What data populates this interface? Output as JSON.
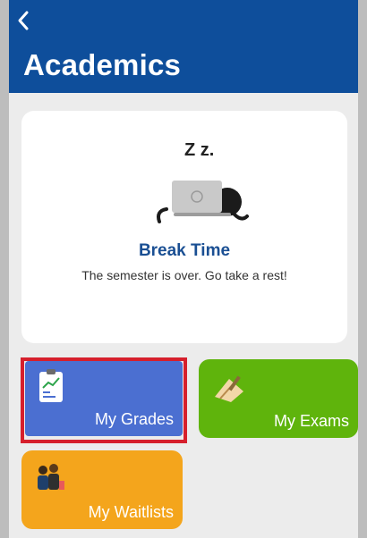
{
  "header": {
    "title": "Academics"
  },
  "break_card": {
    "title": "Break Time",
    "subtitle": "The semester is over. Go take a rest!",
    "zzz": "Z z."
  },
  "tiles": [
    {
      "label": "My Grades",
      "color": "#4b6fd1",
      "icon": "grades-icon",
      "selected": true
    },
    {
      "label": "My Exams",
      "color": "#5fb40c",
      "icon": "exams-icon"
    },
    {
      "label": "My Waitlists",
      "color": "#f4a51c",
      "icon": "waitlists-icon"
    }
  ],
  "colors": {
    "header": "#0e4e9b",
    "highlight": "#d61f2c"
  }
}
